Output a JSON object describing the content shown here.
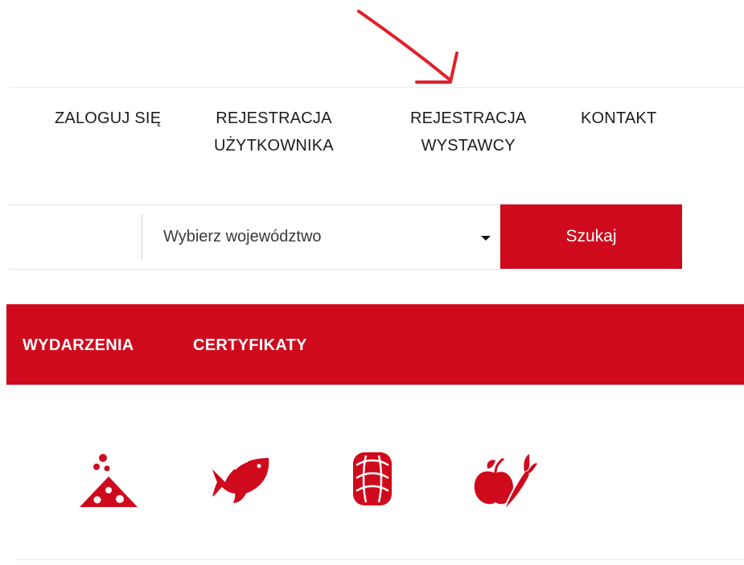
{
  "top_nav": {
    "login": "ZALOGUJ SIĘ",
    "user_registration": [
      "REJESTRACJA",
      "UŻYTKOWNIKA"
    ],
    "exhibitor_registration": [
      "REJESTRACJA",
      "WYSTAWCY"
    ],
    "contact": "KONTAKT"
  },
  "search": {
    "region_select": {
      "selected": "Wybierz województwo"
    },
    "button_label": "Szukaj"
  },
  "main_menu": {
    "items": [
      {
        "label": "WYDARZENIA"
      },
      {
        "label": "CERTYFIKATY"
      }
    ]
  },
  "categories": {
    "icons": [
      "cheese-icon",
      "fish-icon",
      "sausage-icon",
      "fruit-vegetable-icon"
    ]
  },
  "colors": {
    "brand_red": "#cf0a1c",
    "annotation_arrow": "#e0202a"
  }
}
